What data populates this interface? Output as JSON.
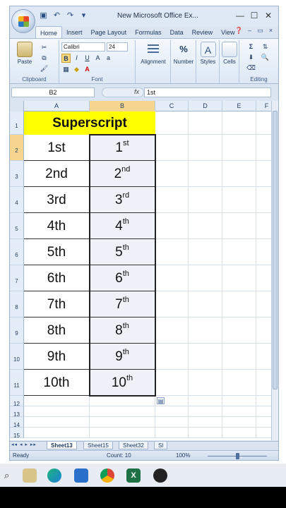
{
  "window": {
    "title": "New Microsoft Office Ex...",
    "qat_icons": [
      "save-icon",
      "undo-icon",
      "redo-icon",
      "customize-icon"
    ]
  },
  "ribbon_tabs": [
    "Home",
    "Insert",
    "Page Layout",
    "Formulas",
    "Data",
    "Review",
    "View"
  ],
  "ribbon": {
    "clipboard": {
      "paste_label": "Paste",
      "group_label": "Clipboard"
    },
    "font": {
      "font_name": "Calibri",
      "font_size": "24",
      "bold": "B",
      "italic": "I",
      "underline": "U",
      "group_label": "Font"
    },
    "alignment": {
      "label": "Alignment"
    },
    "number": {
      "label": "Number",
      "glyph": "%"
    },
    "styles": {
      "label": "Styles",
      "glyph": "A"
    },
    "cells": {
      "label": "Cells"
    },
    "editing": {
      "label": "Editing",
      "sum_glyph": "Σ"
    }
  },
  "formula_bar": {
    "name_box": "B2",
    "fx": "fx",
    "formula": "1st"
  },
  "columns": [
    "A",
    "B",
    "C",
    "D",
    "E",
    "F"
  ],
  "rows": [
    "1",
    "2",
    "3",
    "4",
    "5",
    "6",
    "7",
    "8",
    "9",
    "10",
    "11",
    "12",
    "13",
    "14",
    "15"
  ],
  "header_cell": "Superscript",
  "data_rows": [
    {
      "a": "1st",
      "b_base": "1",
      "b_sup": "st"
    },
    {
      "a": "2nd",
      "b_base": "2",
      "b_sup": "nd"
    },
    {
      "a": "3rd",
      "b_base": "3",
      "b_sup": "rd"
    },
    {
      "a": "4th",
      "b_base": "4",
      "b_sup": "th"
    },
    {
      "a": "5th",
      "b_base": "5",
      "b_sup": "th"
    },
    {
      "a": "6th",
      "b_base": "6",
      "b_sup": "th"
    },
    {
      "a": "7th",
      "b_base": "7",
      "b_sup": "th"
    },
    {
      "a": "8th",
      "b_base": "8",
      "b_sup": "th"
    },
    {
      "a": "9th",
      "b_base": "9",
      "b_sup": "th"
    },
    {
      "a": "10th",
      "b_base": "10",
      "b_sup": "th"
    }
  ],
  "sheets": [
    "Sheet13",
    "Sheet15",
    "Sheet32",
    "Sl"
  ],
  "status": {
    "ready": "Ready",
    "count": "Count: 10",
    "zoom": "100%"
  },
  "colors": {
    "header_fill": "#ffff00",
    "selected_header": "#f6d58f",
    "ribbon_bg": "#dbe5f1"
  }
}
